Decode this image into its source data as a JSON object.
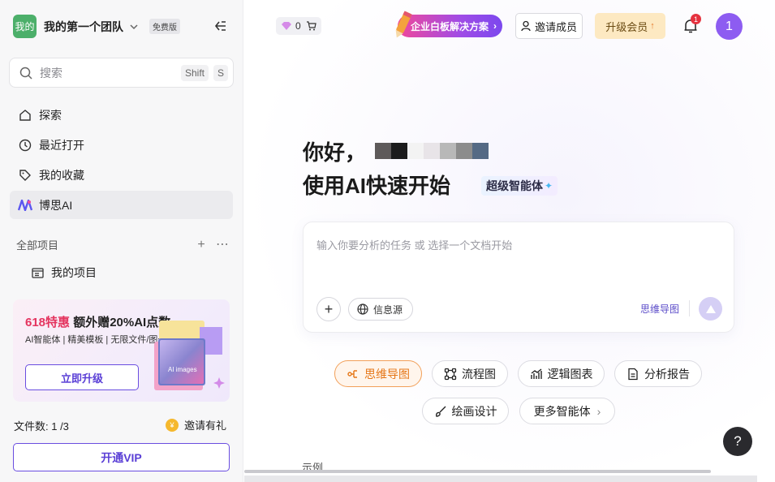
{
  "sidebar": {
    "team_avatar": "我的",
    "team_name": "我的第一个团队",
    "team_badge": "免费版",
    "search": {
      "placeholder": "搜索",
      "shortcut_1": "Shift",
      "shortcut_2": "S"
    },
    "nav": [
      {
        "label": "探索",
        "icon": "home-icon"
      },
      {
        "label": "最近打开",
        "icon": "clock-icon"
      },
      {
        "label": "我的收藏",
        "icon": "tag-icon"
      },
      {
        "label": "博思AI",
        "icon": "boardmix-ai-logo-icon",
        "active": true
      }
    ],
    "projects_header": "全部项目",
    "project_item": "我的项目",
    "promo": {
      "title_highlight": "618特惠",
      "title_rest": "额外赠20%AI点数",
      "subtitle": "AI智能体 | 精美模板 | 无限文件/图元",
      "button": "立即升级",
      "art_text": "AI images"
    },
    "file_count_label": "文件数: 1 /3",
    "invite_reward": "邀请有礼",
    "vip_button": "开通VIP"
  },
  "header": {
    "points": "0",
    "enterprise_button": "企业白板解决方案",
    "invite_button": "邀请成员",
    "upgrade_button": "升级会员",
    "notification_count": "1",
    "user_initial": "1"
  },
  "hero": {
    "greeting": "你好，",
    "subtitle": "使用AI快速开始",
    "agent_tag": "超级智能体"
  },
  "prompt": {
    "placeholder": "输入你要分析的任务 或 选择一个文档开始",
    "source_label": "信息源",
    "mode_label": "思维导图"
  },
  "chips": [
    {
      "label": "思维导图",
      "icon": "mindmap-icon",
      "active": true
    },
    {
      "label": "流程图",
      "icon": "flowchart-icon"
    },
    {
      "label": "逻辑图表",
      "icon": "chart-icon"
    },
    {
      "label": "分析报告",
      "icon": "report-icon"
    },
    {
      "label": "绘画设计",
      "icon": "brush-icon"
    },
    {
      "label": "更多智能体",
      "icon": "chevron-right-icon"
    }
  ],
  "example_label": "示例",
  "help": "?",
  "colors": {
    "accent": "#6a4de0",
    "active_chip": "#e57617",
    "avatar": "#8d5cf1"
  }
}
